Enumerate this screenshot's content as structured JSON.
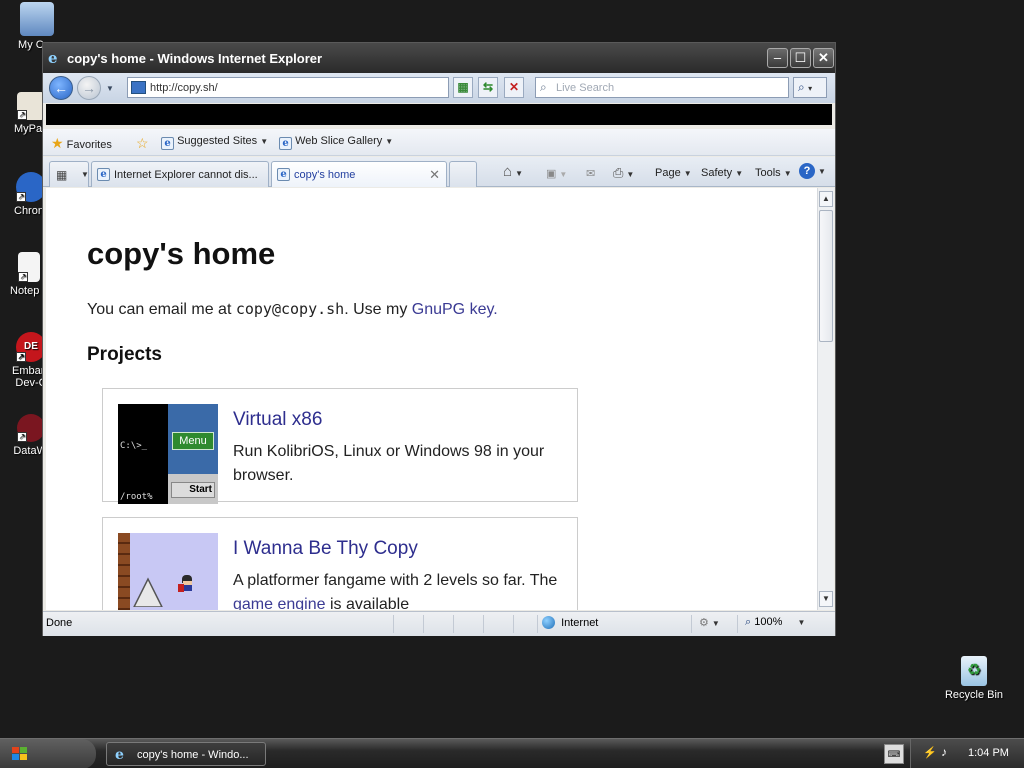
{
  "desktop": {
    "icons": [
      {
        "label": "My Con"
      },
      {
        "label": "MyPa"
      },
      {
        "label": "Chron"
      },
      {
        "label": "Notep"
      },
      {
        "label": "Embarc Dev-C"
      },
      {
        "label": "DataWa"
      }
    ],
    "recycle_bin": "Recycle Bin"
  },
  "window": {
    "title": "copy's home - Windows Internet Explorer"
  },
  "addressbar": {
    "url": "http://copy.sh/",
    "search_placeholder": "Live Search"
  },
  "favorites_bar": {
    "favorites": "Favorites",
    "suggested_sites": "Suggested Sites",
    "web_slice_gallery": "Web Slice Gallery"
  },
  "tabs": [
    {
      "label": "Internet Explorer cannot dis..."
    },
    {
      "label": "copy's home"
    }
  ],
  "command_bar": {
    "page": "Page",
    "safety": "Safety",
    "tools": "Tools"
  },
  "page": {
    "heading": "copy's home",
    "intro_prefix": "You can email me at ",
    "email": "copy@copy.sh",
    "intro_mid": ". Use my ",
    "gpg_link": "GnuPG key",
    "intro_suffix": ".",
    "projects_heading": "Projects",
    "projects": [
      {
        "title": "Virtual x86",
        "description": "Run KolibriOS, Linux or Windows 98 in your browser.",
        "thumb_prompt": "C:\\>_",
        "thumb_root": "/root%",
        "thumb_menu": "Menu",
        "thumb_start": "Start"
      },
      {
        "title": "I Wanna Be Thy Copy",
        "description_prefix": "A platformer fangame with 2 levels so far. The ",
        "description_link": "game engine",
        "description_suffix": " is available"
      }
    ]
  },
  "statusbar": {
    "status": "Done",
    "zone": "Internet",
    "zoom": "100%"
  },
  "taskbar": {
    "task_label": "copy's home - Windo...",
    "clock": "1:04 PM"
  }
}
